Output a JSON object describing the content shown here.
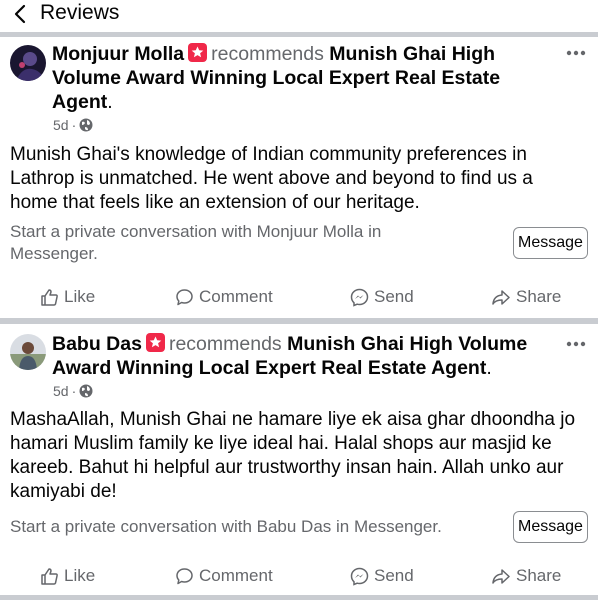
{
  "header": {
    "title": "Reviews"
  },
  "posts": [
    {
      "author": "Monjuur Molla",
      "verb": "recommends",
      "page": "Munish Ghai High Volume Award Winning Local Expert Real Estate Agent",
      "period": ".",
      "time": "5d",
      "dot": "·",
      "body": "Munish Ghai's knowledge of Indian community preferences in Lathrop is unmatched. He went above and beyond to find us a home that feels like an extension of our heritage.",
      "private": "Start a private conversation with Monjuur Molla in Messenger.",
      "message_label": "Message",
      "actions": {
        "like": "Like",
        "comment": "Comment",
        "send": "Send",
        "share": "Share"
      }
    },
    {
      "author": "Babu Das",
      "verb": "recommends",
      "page": "Munish Ghai High Volume Award Winning Local Expert Real Estate Agent",
      "period": ".",
      "time": "5d",
      "dot": "·",
      "body": "MashaAllah, Munish Ghai ne hamare liye ek aisa ghar dhoondha jo hamari Muslim family ke liye ideal hai. Halal shops aur masjid ke kareeb. Bahut hi helpful aur trustworthy insan hain. Allah unko aur kamiyabi de!",
      "private": "Start a private conversation with Babu Das in Messenger.",
      "message_label": "Message",
      "actions": {
        "like": "Like",
        "comment": "Comment",
        "send": "Send",
        "share": "Share"
      }
    }
  ],
  "colors": {
    "badge": "#f02849",
    "secondary_text": "#65676b",
    "separator": "#c9ccd1"
  },
  "icons": [
    "back-arrow-icon",
    "recommendation-badge-icon",
    "globe-icon",
    "more-options-icon",
    "like-icon",
    "comment-icon",
    "messenger-icon",
    "share-icon"
  ]
}
